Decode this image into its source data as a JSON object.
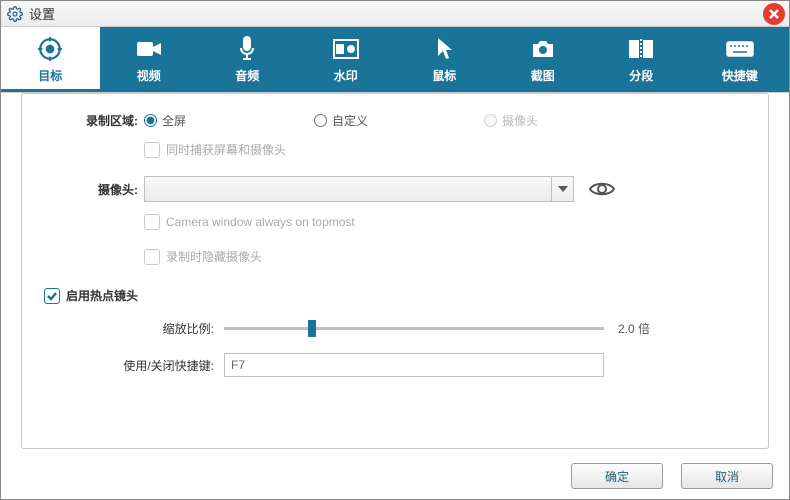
{
  "window": {
    "title": "设置"
  },
  "tabs": [
    {
      "label": "目标",
      "icon": "target"
    },
    {
      "label": "视频",
      "icon": "video"
    },
    {
      "label": "音频",
      "icon": "mic"
    },
    {
      "label": "水印",
      "icon": "watermark"
    },
    {
      "label": "鼠标",
      "icon": "cursor"
    },
    {
      "label": "截图",
      "icon": "camera"
    },
    {
      "label": "分段",
      "icon": "segment"
    },
    {
      "label": "快捷键",
      "icon": "keyboard"
    }
  ],
  "recarea": {
    "label": "录制区域:",
    "options": {
      "fullscreen": "全屏",
      "custom": "自定义",
      "camera": "摄像头"
    },
    "selected": "fullscreen",
    "capture_both_checkbox": "同时捕获屏幕和摄像头"
  },
  "camera": {
    "label": "摄像头:",
    "value": "",
    "always_top": "Camera window always on topmost",
    "hide_when_rec": "录制时隐藏摄像头"
  },
  "hotspot": {
    "enable_label": "启用热点镜头",
    "zoom_label": "缩放比例:",
    "zoom_value": "2.0 倍",
    "hotkey_label": "使用/关闭快捷键:",
    "hotkey_value": "F7"
  },
  "buttons": {
    "ok": "确定",
    "cancel": "取消"
  }
}
